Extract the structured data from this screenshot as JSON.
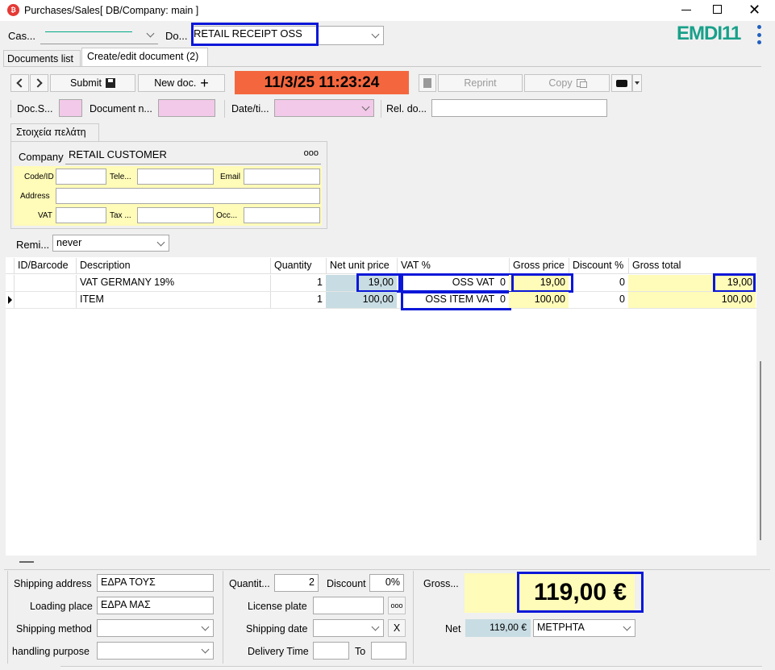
{
  "window": {
    "title": "Purchases/Sales",
    "db": "[ DB/Company: main ]",
    "brand": "EMDI11"
  },
  "top": {
    "cash_label": "Cas...",
    "cash_value": "",
    "doc_label": "Do...",
    "doc_value": "RETAIL RECEIPT OSS"
  },
  "tabs": [
    "Documents list",
    "Create/edit document (2)"
  ],
  "toolbar": {
    "submit": "Submit",
    "new_doc": "New doc.",
    "datetime": "11/3/25 11:23:24",
    "reprint": "Reprint",
    "copy": "Copy"
  },
  "row2": {
    "docs_label": "Doc.S...",
    "docn_label": "Document n...",
    "date_label": "Date/ti...",
    "rel_label": "Rel. do..."
  },
  "customer": {
    "tab": "Στοιχεία πελάτη",
    "company_label": "Company",
    "company_value": "RETAIL CUSTOMER",
    "code_label": "Code/ID",
    "tele_label": "Tele...",
    "email_label": "Email",
    "address_label": "Address",
    "vat_label": "VAT",
    "tax_label": "Tax ...",
    "occ_label": "Occ..."
  },
  "remi": {
    "label": "Remi...",
    "value": "never"
  },
  "grid": {
    "headers": [
      "ID/Barcode",
      "Description",
      "Quantity",
      "Net unit price",
      "VAT %",
      "Gross price",
      "Discount %",
      "Gross total"
    ],
    "rows": [
      {
        "id": "",
        "desc": "VAT GERMANY 19%",
        "qty": "1",
        "net": "19,00",
        "vat": "OSS VAT",
        "vatv": "0",
        "gross": "19,00",
        "disc": "0",
        "total": "19,00"
      },
      {
        "id": "",
        "desc": "ITEM",
        "qty": "1",
        "net": "100,00",
        "vat": "OSS ITEM VAT",
        "vatv": "0",
        "gross": "100,00",
        "disc": "0",
        "total": "100,00"
      }
    ]
  },
  "bottom": {
    "ship_addr_label": "Shipping address",
    "ship_addr": "ΕΔΡΑ ΤΟΥΣ",
    "loading_label": "Loading place",
    "loading": "ΕΔΡΑ ΜΑΣ",
    "ship_method_label": "Shipping method",
    "handling_label": "handling purpose",
    "qty_label": "Quantit...",
    "qty": "2",
    "discount_label": "Discount",
    "discount": "0%",
    "license_label": "License plate",
    "ship_date_label": "Shipping date",
    "x": "X",
    "delivery_label": "Delivery Time",
    "to_label": "To",
    "gross_label": "Gross...",
    "gross_total": "119,00 €",
    "net_label": "Net",
    "net_value": "119,00 €",
    "payment": "ΜΕΤΡΗΤΑ"
  }
}
